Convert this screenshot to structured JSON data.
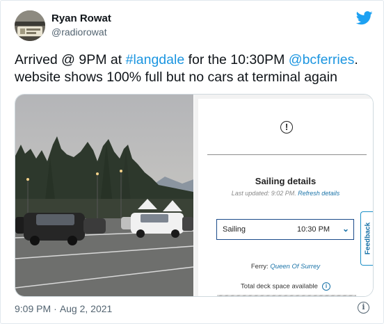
{
  "tweet": {
    "author": {
      "name": "Ryan Rowat",
      "handle": "@radiorowat"
    },
    "text_segments": [
      {
        "text": "Arrived @ 9PM at ",
        "link": false
      },
      {
        "text": "#langdale",
        "link": true
      },
      {
        "text": " for the 10:30PM ",
        "link": false
      },
      {
        "text": "@bcferries",
        "link": true
      },
      {
        "text": ". website shows 100% full but no cars at terminal again",
        "link": false
      }
    ],
    "time": "9:09 PM",
    "separator": "·",
    "date": "Aug 2, 2021",
    "icons": {
      "brand": "twitter-bird-icon",
      "info": "info-icon"
    }
  },
  "screenshot": {
    "heading": "Sailing details",
    "updated_prefix": "Last updated: 9:02 PM.",
    "refresh_label": "Refresh details",
    "select_label": "Sailing",
    "select_value": "10:30 PM",
    "feedback_label": "Feedback",
    "ferry_label": "Ferry:",
    "ferry_name": "Queen Of Surrey",
    "deck_label": "Total deck space available"
  },
  "colors": {
    "link": "#1b95e0",
    "brand": "#1da1f2",
    "muted": "#536471",
    "site_blue": "#1a73a8"
  }
}
